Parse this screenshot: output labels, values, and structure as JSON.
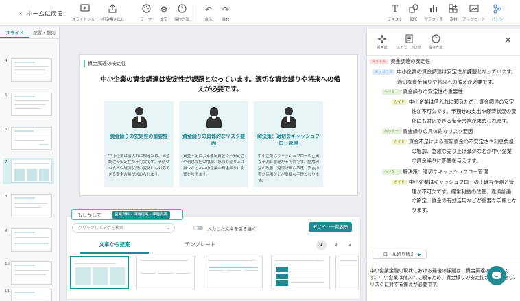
{
  "topbar": {
    "home_label": "ホームに戻る",
    "tools_left": [
      {
        "label": "スライドショー",
        "icon": "play-icon"
      },
      {
        "label": "共有/書き出し",
        "icon": "share-icon"
      },
      {
        "label": "テーマ",
        "icon": "palette-icon"
      },
      {
        "label": "設定",
        "icon": "gear-icon"
      },
      {
        "label": "操作方法",
        "icon": "help-icon"
      }
    ],
    "tools_mid": [
      {
        "label": "戻る",
        "icon": "undo-icon"
      },
      {
        "label": "進む",
        "icon": "redo-icon"
      }
    ],
    "tools_right": [
      {
        "label": "テキスト",
        "icon": "text-icon"
      },
      {
        "label": "図形",
        "icon": "shape-icon"
      },
      {
        "label": "グラフ・表",
        "icon": "chart-icon"
      },
      {
        "label": "素材",
        "icon": "material-icon"
      },
      {
        "label": "アップロード",
        "icon": "image-upload-icon"
      },
      {
        "label": "パーツ",
        "icon": "parts-icon"
      }
    ]
  },
  "left_panel": {
    "tabs": [
      "スライド",
      "配置・整列"
    ],
    "slide_numbers": [
      "4",
      "5",
      "6",
      "7",
      "8",
      "9",
      "10",
      "11"
    ]
  },
  "slide": {
    "title": "資金調達の安定性",
    "message": "中小企業の資金調達は安定性が課題となっています。適切な資金繰りや将来への備えが必要です。",
    "cards": [
      {
        "heading": "資金繰りの安定性の重要性",
        "body": "中小企業は借入れに頼るため、資金調達の安定性が不可欠です。予期せぬ支出や経済状況の変化にも対応できる安全余裕が求められます。"
      },
      {
        "heading": "資金繰りの具体的なリスク要因",
        "body": "資金不足による運転資金の不安定さや利息負担の増加、急激な売り上げ減少などが中小企業の資金繰りに影響を与えます。"
      },
      {
        "heading": "解決策：適切なキャッシュフロー管理",
        "body": "中小企業はキャッシュフローの正確な予測と管理が不可欠です。経常利益の改善、返済計画の策定、資金の有効活用などが重要な手段となります。"
      }
    ]
  },
  "bottom_panel": {
    "tag_label": "もしかして",
    "tag_chip": "営業資料 - 課題提案 - 課題提案",
    "search_placeholder": "クリックしてタグを検索",
    "toggle_label": "入力した文章を引き継ぐ",
    "design_list_button": "デザイン一覧表示",
    "tabs": [
      "文章から提案",
      "テンプレート"
    ],
    "pages": [
      "1",
      "2",
      "3"
    ]
  },
  "right_panel": {
    "tools": [
      {
        "label": "AI生成",
        "icon": "sparkle-icon"
      },
      {
        "label": "入力モード切替",
        "icon": "document-icon"
      },
      {
        "label": "操作方法",
        "icon": "help-icon"
      }
    ],
    "badges": {
      "title": "タイトル",
      "message": "メッセージ",
      "header": "ヘッダー",
      "guide": "ガイド"
    },
    "outline": {
      "title": "資金調達の安定性",
      "message": [
        "中小企業の資金調達は安定性が課題となっています。",
        "適切な資金繰りや将来への備えが必要です。"
      ],
      "sections": [
        {
          "header": "資金繰りの安定性の重要性",
          "guide": [
            "中小企業は借入れに頼るため、資金調達の安定",
            "性が不可欠です。予期せぬ支出や経済状況の変",
            "化にも対応できる安全余裕が求められます。"
          ]
        },
        {
          "header": "資金繰りの具体的なリスク要因",
          "guide": [
            "資金不足による運転資金の不安定さや利息負担",
            "の増加、急激な売り上げ減少などが中小企業",
            "の資金繰りに影響を与えます。"
          ]
        },
        {
          "header": "解決策：適切なキャッシュフロー管理",
          "guide": [
            "中小企業はキャッシュフローの正確な予測と管",
            "理が不可欠です。経常利益の改善、返済計画",
            "の策定、資金の有効活用などが重要な手段となります。"
          ]
        }
      ]
    },
    "role_switch": "ロール切り替え",
    "preview": "中小企業金融の現状における最後の課題は、資金調達の安定性です。中小企業は借入れに頼るため、資金繰りの安定性が課題であり、リスクに対する備えが必要です。"
  },
  "colors": {
    "accent": "#1e8a92",
    "card_bg": "#e7f4f5"
  }
}
